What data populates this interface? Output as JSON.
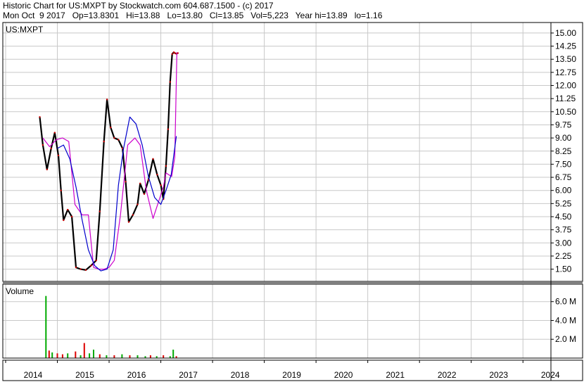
{
  "header": {
    "title": "Historic Chart for US:MXPT by Stockwatch.com 604.687.1500 - (c) 2017",
    "quote": "Mon Oct  9 2017   Op=13.8301   Hi=13.88   Lo=13.80   Cl=13.85   Vol=5,223   Year hi=13.89   lo=1.16"
  },
  "price_panel": {
    "label": "US:MXPT"
  },
  "volume_panel": {
    "label": "Volume"
  },
  "colors": {
    "price_bars": "#000000",
    "ma_short": "#cc00cc",
    "ma_long": "#0000cc",
    "volume_up": "#00aa00",
    "volume_down": "#dd0000",
    "grid": "#c8c8c8"
  },
  "chart_data": [
    {
      "type": "line",
      "title": "US:MXPT",
      "y_ticks": [
        "15.00",
        "14.25",
        "13.50",
        "12.75",
        "12.00",
        "11.25",
        "10.50",
        "9.75",
        "9.00",
        "8.25",
        "7.50",
        "6.75",
        "6.00",
        "5.25",
        "4.50",
        "3.75",
        "3.00",
        "2.25",
        "1.50"
      ],
      "ylim": [
        0.8,
        15.6
      ],
      "grid": true,
      "series": [
        {
          "values_x": [
            2014.66,
            2014.72,
            2014.8,
            2014.88,
            2014.95,
            2015.02,
            2015.07,
            2015.12,
            2015.2,
            2015.28,
            2015.36,
            2015.45,
            2015.55,
            2015.65,
            2015.75,
            2015.82,
            2015.9,
            2015.96,
            2016.03,
            2016.1,
            2016.18,
            2016.26,
            2016.32,
            2016.38,
            2016.46,
            2016.55,
            2016.6,
            2016.68,
            2016.76,
            2016.85,
            2016.93,
            2017.0,
            2017.05,
            2017.1,
            2017.14,
            2017.18,
            2017.22,
            2017.25,
            2017.27,
            2017.3,
            2017.33
          ],
          "values_y": [
            10.2,
            8.6,
            7.2,
            8.4,
            9.3,
            8.0,
            6.0,
            4.3,
            4.9,
            4.5,
            1.6,
            1.5,
            1.45,
            1.7,
            2.0,
            4.8,
            8.8,
            11.2,
            9.6,
            9.0,
            8.9,
            8.4,
            6.5,
            4.2,
            4.6,
            5.2,
            6.4,
            5.8,
            6.6,
            7.8,
            6.9,
            6.3,
            5.5,
            7.4,
            9.5,
            12.2,
            13.8,
            13.9,
            13.85,
            13.82,
            13.85
          ]
        },
        {
          "values_x": [
            2014.72,
            2014.85,
            2014.98,
            2015.1,
            2015.22,
            2015.34,
            2015.48,
            2015.6,
            2015.7,
            2015.8,
            2015.9,
            2016.0,
            2016.1,
            2016.22,
            2016.36,
            2016.5,
            2016.6,
            2016.72,
            2016.85,
            2016.95,
            2017.05,
            2017.1,
            2017.15,
            2017.21,
            2017.27,
            2017.31
          ],
          "values_y": [
            9.0,
            8.5,
            8.9,
            9.0,
            8.8,
            5.2,
            4.6,
            4.6,
            1.6,
            1.5,
            1.5,
            1.6,
            2.0,
            4.6,
            8.6,
            9.0,
            8.6,
            6.0,
            4.4,
            5.3,
            6.2,
            7.0,
            6.9,
            6.8,
            7.9,
            13.9
          ]
        },
        {
          "values_x": [
            2015.0,
            2015.12,
            2015.24,
            2015.36,
            2015.48,
            2015.6,
            2015.72,
            2015.84,
            2015.96,
            2016.08,
            2016.18,
            2016.28,
            2016.4,
            2016.52,
            2016.64,
            2016.76,
            2016.88,
            2017.0,
            2017.1,
            2017.2,
            2017.3
          ],
          "values_y": [
            8.4,
            8.6,
            7.8,
            6.2,
            4.3,
            2.6,
            1.7,
            1.4,
            1.5,
            2.6,
            6.3,
            8.4,
            10.2,
            9.8,
            8.6,
            6.8,
            5.6,
            5.2,
            6.0,
            6.9,
            9.1
          ]
        }
      ],
      "x_ticks": [
        "2014",
        "2015",
        "2016",
        "2017",
        "2018",
        "2019",
        "2020",
        "2021",
        "2022",
        "2023",
        "2024"
      ]
    },
    {
      "type": "bar",
      "title": "Volume",
      "y_ticks": [
        "6.0 M",
        "4.0 M",
        "2.0 M"
      ],
      "ylim": [
        0,
        7.4
      ],
      "grid": true,
      "x": [
        2014.78,
        2014.84,
        2014.9,
        2015.0,
        2015.1,
        2015.2,
        2015.35,
        2015.45,
        2015.52,
        2015.62,
        2015.7,
        2015.82,
        2015.95,
        2016.1,
        2016.25,
        2016.4,
        2016.55,
        2016.7,
        2016.8,
        2016.92,
        2017.05,
        2017.18,
        2017.24,
        2017.3
      ],
      "values": [
        6.6,
        0.8,
        0.6,
        0.5,
        0.4,
        0.5,
        0.7,
        0.3,
        1.6,
        0.5,
        0.9,
        0.4,
        0.3,
        0.3,
        0.4,
        0.3,
        0.3,
        0.2,
        0.3,
        0.2,
        0.3,
        0.2,
        0.9,
        0.2
      ],
      "colors": [
        "up",
        "down",
        "up",
        "down",
        "down",
        "up",
        "down",
        "up",
        "down",
        "up",
        "up",
        "down",
        "up",
        "down",
        "up",
        "down",
        "up",
        "up",
        "down",
        "up",
        "down",
        "up",
        "up",
        "down"
      ]
    }
  ]
}
